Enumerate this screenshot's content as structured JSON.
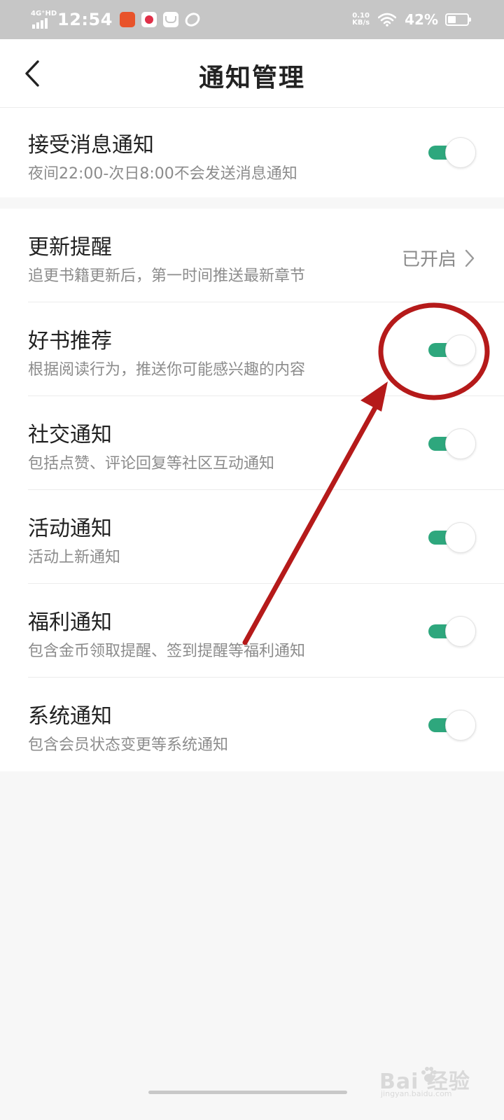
{
  "status_bar": {
    "network": "4G⁺HD",
    "time": "12:54",
    "speed_value": "0.10",
    "speed_unit": "KB/s",
    "battery": "42%",
    "battery_level": 0.42,
    "app_icons": [
      "news-app-icon",
      "shopping-app-icon",
      "mail-app-icon",
      "browser-app-icon"
    ]
  },
  "nav": {
    "title": "通知管理",
    "back_icon": "chevron-left-icon"
  },
  "section1": {
    "title": "接受消息通知",
    "subtitle": "夜间22:00-次日8:00不会发送消息通知",
    "enabled": true
  },
  "section2": {
    "update": {
      "title": "更新提醒",
      "subtitle": "追更书籍更新后，第一时间推送最新章节",
      "status": "已开启"
    },
    "items": [
      {
        "title": "好书推荐",
        "subtitle": "根据阅读行为，推送你可能感兴趣的内容",
        "enabled": true
      },
      {
        "title": "社交通知",
        "subtitle": "包括点赞、评论回复等社区互动通知",
        "enabled": true
      },
      {
        "title": "活动通知",
        "subtitle": "活动上新通知",
        "enabled": true
      },
      {
        "title": "福利通知",
        "subtitle": "包含金币领取提醒、签到提醒等福利通知",
        "enabled": true
      },
      {
        "title": "系统通知",
        "subtitle": "包含会员状态变更等系统通知",
        "enabled": true
      }
    ]
  },
  "colors": {
    "toggle_on": "#2ea77d",
    "annotation": "#b51a1a",
    "status_bar": "#c6c6c6"
  },
  "watermark": {
    "text": "Bai  经验",
    "url": "jingyan.baidu.com"
  }
}
